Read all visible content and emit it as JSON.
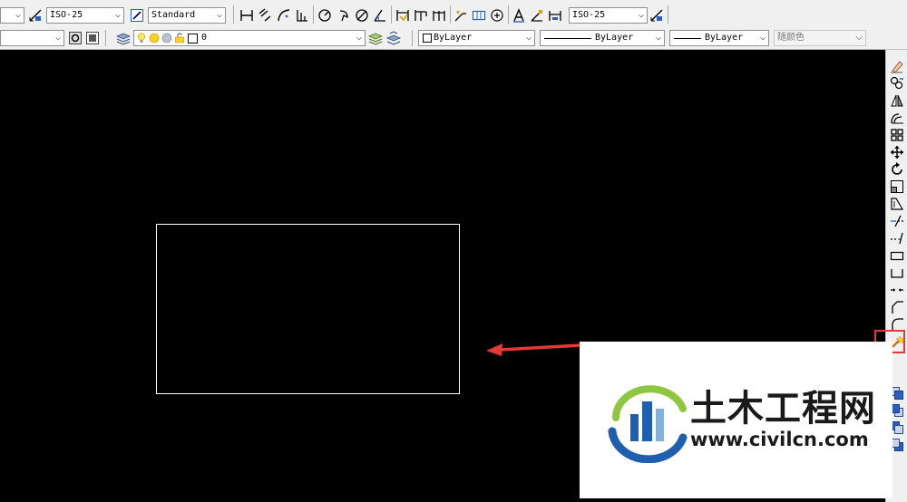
{
  "toolbar_top": {
    "dimstyle_combo": "ISO-25",
    "textstyle_combo": "Standard",
    "dimstyle_combo2": "ISO-25"
  },
  "toolbar_layers": {
    "layer_name": "0",
    "color_combo": "ByLayer",
    "linetype_combo": "ByLayer",
    "lineweight_combo": "ByLayer",
    "plotstyle_combo": "随颜色"
  },
  "watermark": {
    "name": "土木工程网",
    "url": "www.civilcn.com"
  },
  "colors": {
    "highlight": "#e53935",
    "arrow": "#e53935",
    "logo_blue": "#1f5fb0",
    "logo_green": "#8dc63f"
  }
}
